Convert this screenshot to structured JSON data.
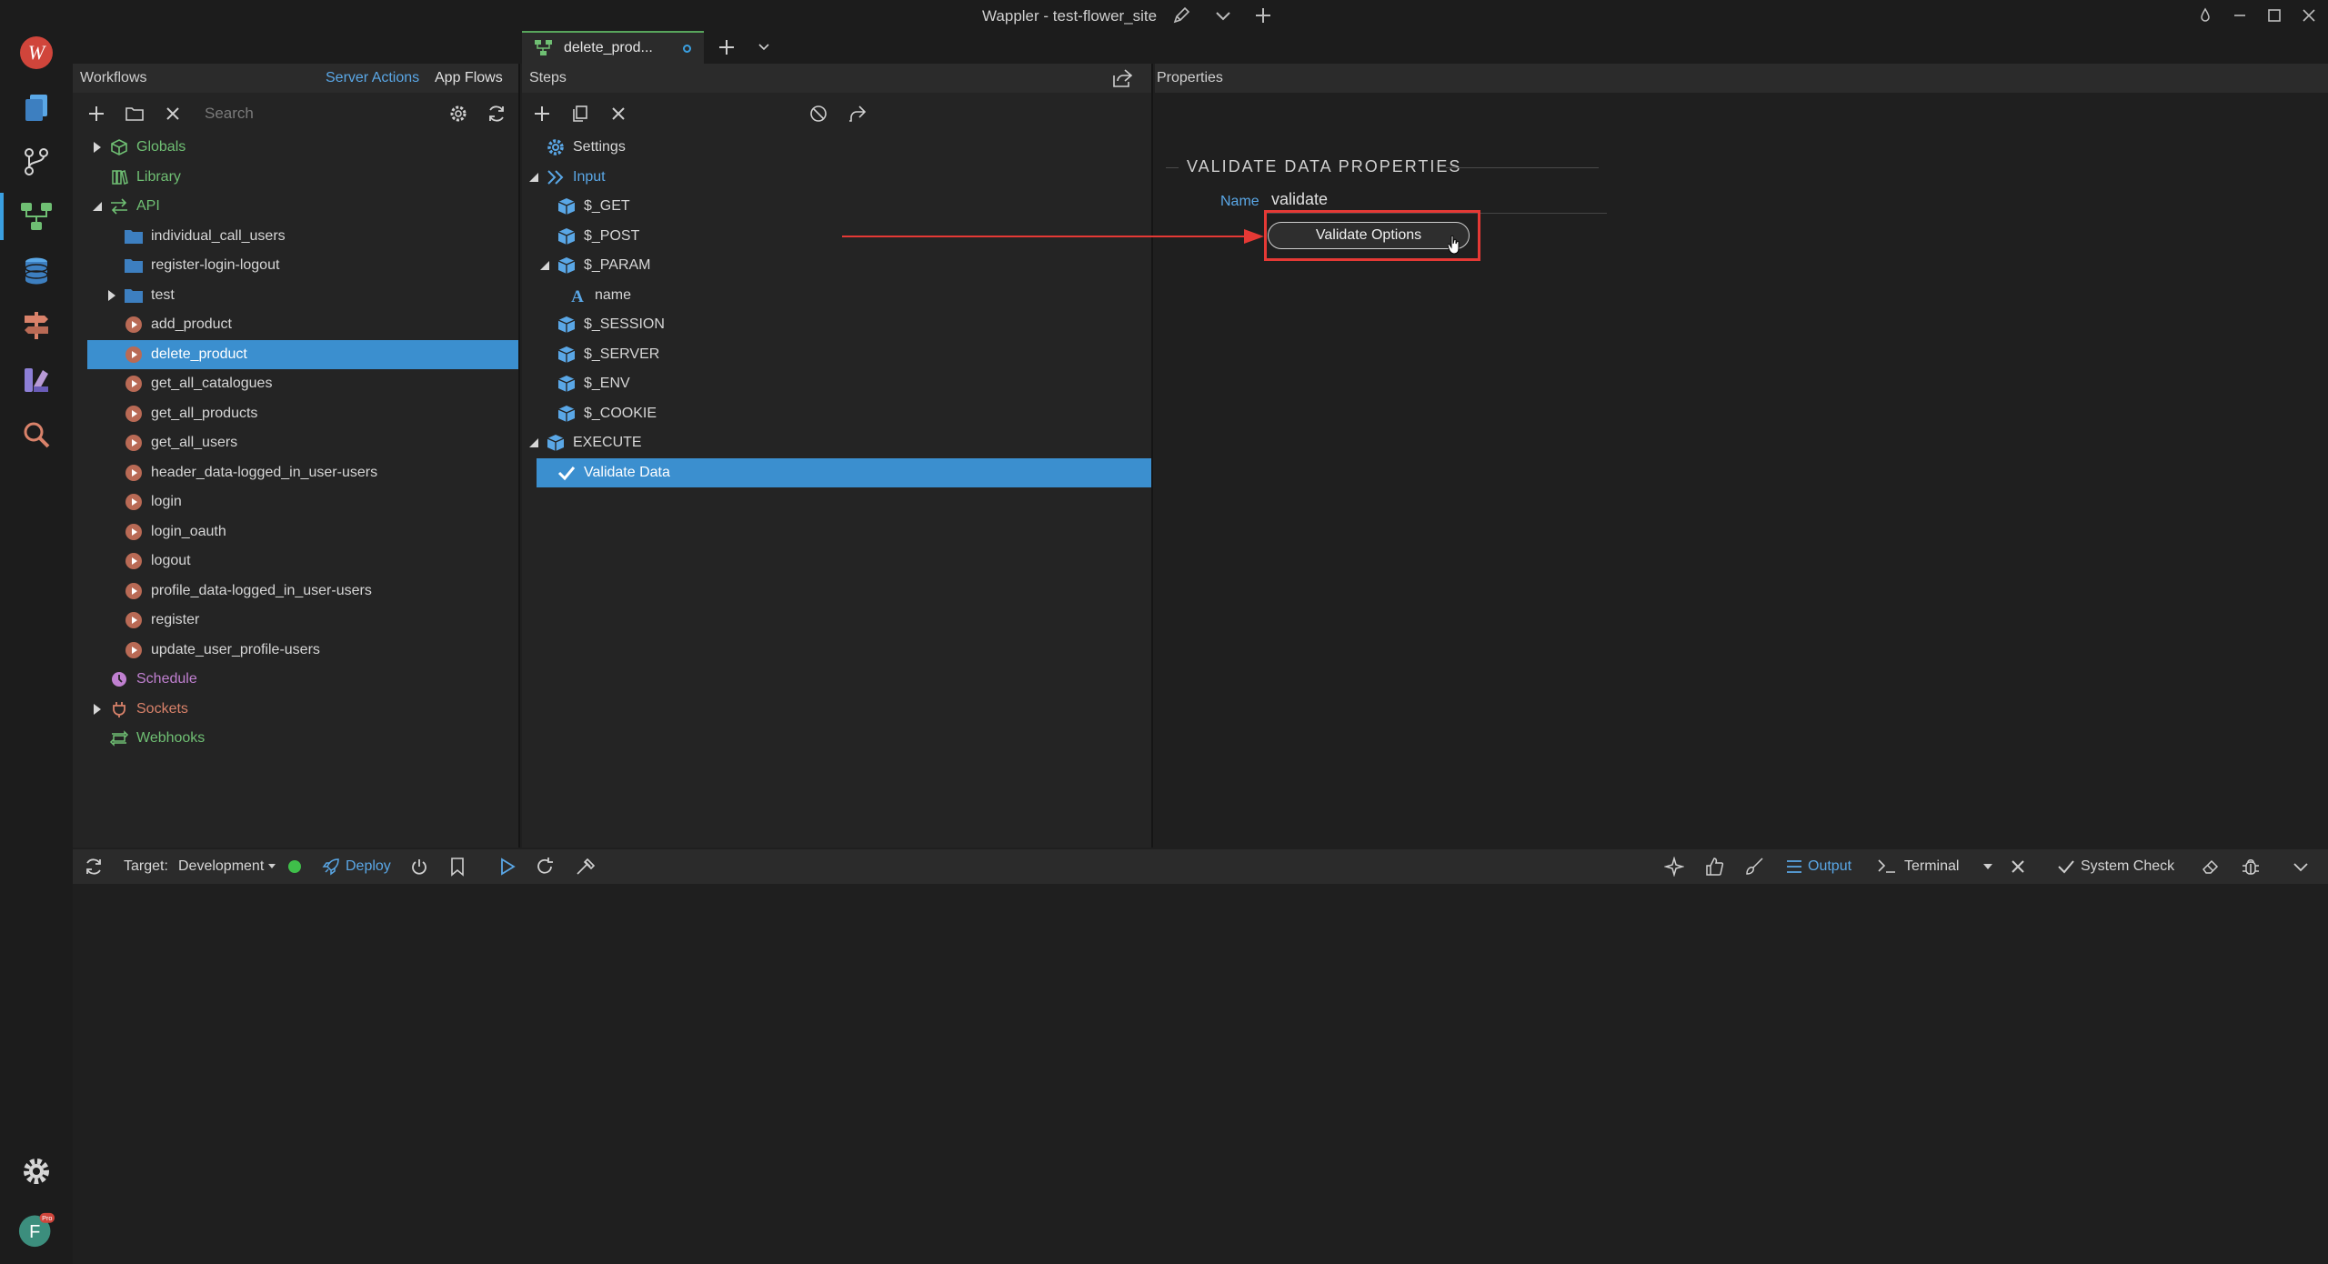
{
  "window": {
    "title": "Wappler - test-flower_site",
    "controls": [
      "pencil-icon",
      "chevron-down-icon",
      "plus-icon",
      "drop-icon",
      "minimize-icon",
      "maximize-icon",
      "close-icon"
    ]
  },
  "activity_bar": {
    "items": [
      "pages-icon",
      "git-icon",
      "workflows-icon",
      "database-icon",
      "routing-icon",
      "design-icon",
      "search-icon"
    ],
    "bottom": {
      "settings": "gear-icon",
      "avatar_letter": "F",
      "pro_badge": "Pro"
    }
  },
  "editor_tab": {
    "label": "delete_prod..."
  },
  "workflows_panel": {
    "title": "Workflows",
    "tabs": [
      "Server Actions",
      "App Flows"
    ],
    "search_placeholder": "Search",
    "tree": [
      {
        "label": "Globals",
        "level": 0,
        "caret": "right",
        "icon": "cube",
        "color": "#6fbf73"
      },
      {
        "label": "Library",
        "level": 0,
        "caret": "",
        "icon": "library",
        "color": "#6fbf73"
      },
      {
        "label": "API",
        "level": 0,
        "caret": "down",
        "icon": "api",
        "color": "#6fbf73"
      },
      {
        "label": "individual_call_users",
        "level": 1,
        "caret": "",
        "icon": "folder",
        "color": "#d6d6d6"
      },
      {
        "label": "register-login-logout",
        "level": 1,
        "caret": "",
        "icon": "folder",
        "color": "#d6d6d6"
      },
      {
        "label": "test",
        "level": 1,
        "caret": "right",
        "icon": "folder",
        "color": "#d6d6d6"
      },
      {
        "label": "add_product",
        "level": 1,
        "caret": "",
        "icon": "play",
        "color": "#d6d6d6"
      },
      {
        "label": "delete_product",
        "level": 1,
        "caret": "",
        "icon": "play",
        "color": "#ffffff",
        "selected": true
      },
      {
        "label": "get_all_catalogues",
        "level": 1,
        "caret": "",
        "icon": "play",
        "color": "#d6d6d6"
      },
      {
        "label": "get_all_products",
        "level": 1,
        "caret": "",
        "icon": "play",
        "color": "#d6d6d6"
      },
      {
        "label": "get_all_users",
        "level": 1,
        "caret": "",
        "icon": "play",
        "color": "#d6d6d6"
      },
      {
        "label": "header_data-logged_in_user-users",
        "level": 1,
        "caret": "",
        "icon": "play",
        "color": "#d6d6d6"
      },
      {
        "label": "login",
        "level": 1,
        "caret": "",
        "icon": "play",
        "color": "#d6d6d6"
      },
      {
        "label": "login_oauth",
        "level": 1,
        "caret": "",
        "icon": "play",
        "color": "#d6d6d6"
      },
      {
        "label": "logout",
        "level": 1,
        "caret": "",
        "icon": "play",
        "color": "#d6d6d6"
      },
      {
        "label": "profile_data-logged_in_user-users",
        "level": 1,
        "caret": "",
        "icon": "play",
        "color": "#d6d6d6"
      },
      {
        "label": "register",
        "level": 1,
        "caret": "",
        "icon": "play",
        "color": "#d6d6d6"
      },
      {
        "label": "update_user_profile-users",
        "level": 1,
        "caret": "",
        "icon": "play",
        "color": "#d6d6d6"
      },
      {
        "label": "Schedule",
        "level": 0,
        "caret": "",
        "icon": "clock",
        "color": "#c080d0"
      },
      {
        "label": "Sockets",
        "level": 0,
        "caret": "right",
        "icon": "plug",
        "color": "#d9826a"
      },
      {
        "label": "Webhooks",
        "level": 0,
        "caret": "",
        "icon": "webhook",
        "color": "#6fbf73"
      }
    ]
  },
  "steps_panel": {
    "title": "Steps",
    "tree": [
      {
        "label": "Settings",
        "level": 0,
        "caret": "",
        "icon": "gear",
        "color": "#d6d6d6"
      },
      {
        "label": "Input",
        "level": 0,
        "caret": "down",
        "icon": "input",
        "color": "#5aa7e6"
      },
      {
        "label": "$_GET",
        "level": 1,
        "caret": "",
        "icon": "box",
        "color": "#d6d6d6"
      },
      {
        "label": "$_POST",
        "level": 1,
        "caret": "",
        "icon": "box",
        "color": "#d6d6d6"
      },
      {
        "label": "$_PARAM",
        "level": 1,
        "caret": "down",
        "icon": "box",
        "color": "#d6d6d6"
      },
      {
        "label": "name",
        "level": 2,
        "caret": "",
        "icon": "text",
        "color": "#d6d6d6"
      },
      {
        "label": "$_SESSION",
        "level": 1,
        "caret": "",
        "icon": "box",
        "color": "#d6d6d6"
      },
      {
        "label": "$_SERVER",
        "level": 1,
        "caret": "",
        "icon": "box",
        "color": "#d6d6d6"
      },
      {
        "label": "$_ENV",
        "level": 1,
        "caret": "",
        "icon": "box",
        "color": "#d6d6d6"
      },
      {
        "label": "$_COOKIE",
        "level": 1,
        "caret": "",
        "icon": "box",
        "color": "#d6d6d6"
      },
      {
        "label": "EXECUTE",
        "level": 0,
        "caret": "down",
        "icon": "box",
        "color": "#d6d6d6"
      },
      {
        "label": "Validate Data",
        "level": 1,
        "caret": "",
        "icon": "check",
        "color": "#ffffff",
        "selected": true
      }
    ]
  },
  "properties_panel": {
    "title": "Properties",
    "section_title": "VALIDATE DATA PROPERTIES",
    "name_label": "Name",
    "name_value": "validate",
    "validate_button": "Validate Options"
  },
  "bottom_bar": {
    "target_label": "Target:",
    "target_value": "Development",
    "deploy": "Deploy",
    "output": "Output",
    "terminal": "Terminal",
    "system_check": "System Check"
  },
  "colors": {
    "accent": "#3a9fe0",
    "selection": "#3b8fcf",
    "highlight": "#e53935",
    "status_ok": "#3fbf4a"
  }
}
